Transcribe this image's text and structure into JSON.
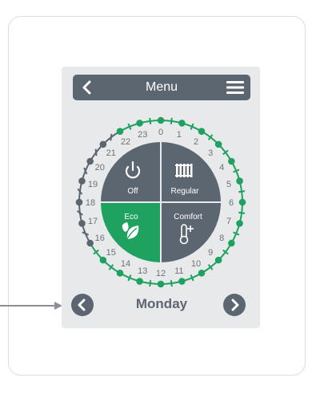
{
  "header": {
    "title": "Menu"
  },
  "hours": [
    "0",
    "1",
    "2",
    "3",
    "4",
    "5",
    "6",
    "7",
    "8",
    "9",
    "10",
    "11",
    "12",
    "13",
    "14",
    "15",
    "16",
    "17",
    "18",
    "19",
    "20",
    "21",
    "22",
    "23"
  ],
  "ring_schedule": [
    "g",
    "g",
    "g",
    "g",
    "g",
    "g",
    "g",
    "g",
    "g",
    "g",
    "g",
    "g",
    "g",
    "g",
    "g",
    "g",
    "x",
    "x",
    "x",
    "x",
    "x",
    "x",
    "g",
    "g"
  ],
  "modes": {
    "off": "Off",
    "regular": "Regular",
    "eco": "Eco",
    "comfort": "Comfort"
  },
  "active_mode": "eco",
  "day": "Monday",
  "colors": {
    "green": "#1fa15f",
    "slate": "#5c6670",
    "light": "#e8e9eb"
  },
  "icons": {
    "back": "chevron-left-icon",
    "menu": "hamburger-icon",
    "off": "power-icon",
    "regular": "radiator-icon",
    "eco": "leaf-icon",
    "comfort": "thermometer-plus-icon"
  }
}
